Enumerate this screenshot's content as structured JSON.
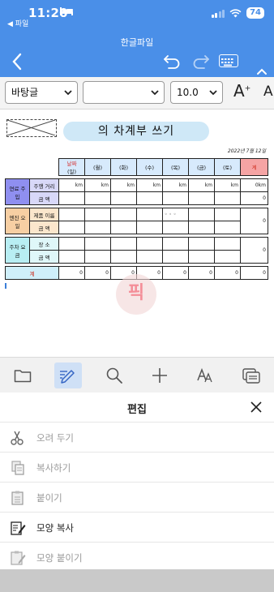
{
  "status": {
    "time": "11:20",
    "back_app": "◀ 파일",
    "battery": "74"
  },
  "header": {
    "document_title": "한글파일"
  },
  "format_bar": {
    "style": "바탕글",
    "font": "",
    "size": "10.0",
    "grow_label": "A",
    "shrink_label": "A"
  },
  "document": {
    "title": "의 차계부 쓰기",
    "date": "2022년  7월  12일",
    "watermark": "픽",
    "header_row": {
      "date_label": "날짜",
      "days": [
        "(일)",
        "(월)",
        "(화)",
        "(수)",
        "(목)",
        "(금)",
        "(토)"
      ],
      "total_label": "계"
    },
    "sections": [
      {
        "category": "연료 주입",
        "rows": [
          {
            "label": "주행 거리",
            "cells": [
              "km",
              "km",
              "km",
              "km",
              "km",
              "km",
              "km"
            ],
            "total": "0km"
          },
          {
            "label": "금      액",
            "cells": [
              "",
              "",
              "",
              "",
              "",
              "",
              ""
            ],
            "total": "0"
          }
        ]
      },
      {
        "category": "엔진 오일",
        "rows": [
          {
            "label": "제품 이름",
            "cells": [
              "",
              "",
              "",
              "",
              "◦ ◦ ◦",
              "",
              ""
            ],
            "total": "0"
          },
          {
            "label": "금      액",
            "cells": [
              "",
              "",
              "",
              "",
              "",
              "",
              ""
            ],
            "total": ""
          }
        ]
      },
      {
        "category": "주차 요금",
        "rows": [
          {
            "label": "장      소",
            "cells": [
              "",
              "",
              "",
              "",
              "",
              "",
              ""
            ],
            "total": "0"
          },
          {
            "label": "금      액",
            "cells": [
              "",
              "",
              "",
              "",
              "",
              "",
              ""
            ],
            "total": ""
          }
        ]
      }
    ],
    "total_row": {
      "label": "계",
      "cells": [
        "0",
        "0",
        "0",
        "0",
        "0",
        "0",
        "0"
      ],
      "total": "0"
    }
  },
  "edit_panel": {
    "title": "편집",
    "items": [
      {
        "label": "오려 두기",
        "icon": "scissors-icon",
        "enabled": false
      },
      {
        "label": "복사하기",
        "icon": "copy-icon",
        "enabled": false
      },
      {
        "label": "붙이기",
        "icon": "paste-icon",
        "enabled": false
      },
      {
        "label": "모양 복사",
        "icon": "format-copy-icon",
        "enabled": true
      },
      {
        "label": "모양 붙이기",
        "icon": "format-paste-icon",
        "enabled": false
      }
    ]
  },
  "colors": {
    "header": "#4a8fe8",
    "accent": "#cfe0f6"
  }
}
